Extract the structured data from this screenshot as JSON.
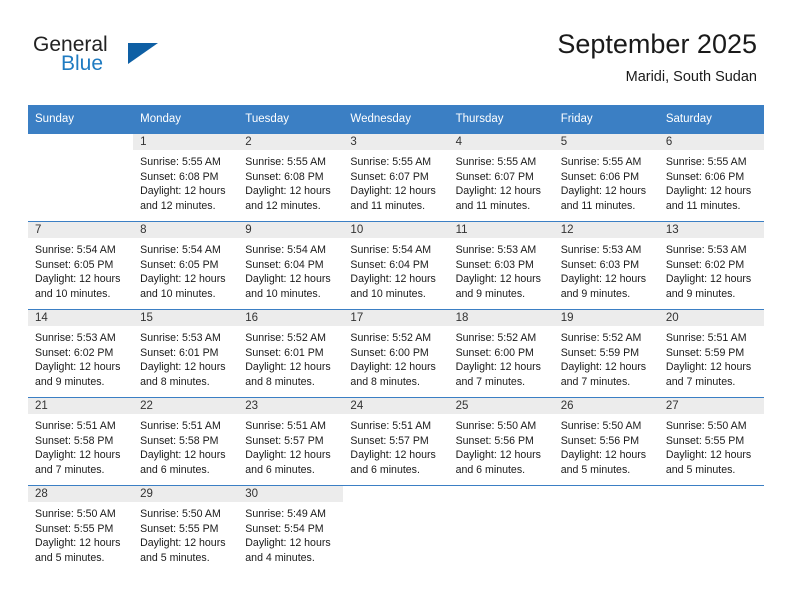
{
  "brand": {
    "word_one": "General",
    "word_two": "Blue",
    "triangle_color": "#0e5fa4",
    "blue_text_color": "#1f7bc1"
  },
  "header": {
    "title": "September 2025",
    "subtitle": "Maridi, South Sudan"
  },
  "theme": {
    "header_row_bg": "#3b7fc4",
    "header_row_text": "#ffffff",
    "daynum_bg": "#f2f2f2",
    "grid_line": "#3b7fc4"
  },
  "calendar": {
    "weekday_headers": [
      "Sunday",
      "Monday",
      "Tuesday",
      "Wednesday",
      "Thursday",
      "Friday",
      "Saturday"
    ],
    "labels": {
      "sunrise": "Sunrise:",
      "sunset": "Sunset:",
      "daylight": "Daylight:"
    },
    "weeks": [
      [
        {
          "day": "",
          "sunrise": "",
          "sunset": "",
          "daylight_line1": "",
          "daylight_line2": ""
        },
        {
          "day": "1",
          "sunrise": "Sunrise: 5:55 AM",
          "sunset": "Sunset: 6:08 PM",
          "daylight_line1": "Daylight: 12 hours",
          "daylight_line2": "and 12 minutes."
        },
        {
          "day": "2",
          "sunrise": "Sunrise: 5:55 AM",
          "sunset": "Sunset: 6:08 PM",
          "daylight_line1": "Daylight: 12 hours",
          "daylight_line2": "and 12 minutes."
        },
        {
          "day": "3",
          "sunrise": "Sunrise: 5:55 AM",
          "sunset": "Sunset: 6:07 PM",
          "daylight_line1": "Daylight: 12 hours",
          "daylight_line2": "and 11 minutes."
        },
        {
          "day": "4",
          "sunrise": "Sunrise: 5:55 AM",
          "sunset": "Sunset: 6:07 PM",
          "daylight_line1": "Daylight: 12 hours",
          "daylight_line2": "and 11 minutes."
        },
        {
          "day": "5",
          "sunrise": "Sunrise: 5:55 AM",
          "sunset": "Sunset: 6:06 PM",
          "daylight_line1": "Daylight: 12 hours",
          "daylight_line2": "and 11 minutes."
        },
        {
          "day": "6",
          "sunrise": "Sunrise: 5:55 AM",
          "sunset": "Sunset: 6:06 PM",
          "daylight_line1": "Daylight: 12 hours",
          "daylight_line2": "and 11 minutes."
        }
      ],
      [
        {
          "day": "7",
          "sunrise": "Sunrise: 5:54 AM",
          "sunset": "Sunset: 6:05 PM",
          "daylight_line1": "Daylight: 12 hours",
          "daylight_line2": "and 10 minutes."
        },
        {
          "day": "8",
          "sunrise": "Sunrise: 5:54 AM",
          "sunset": "Sunset: 6:05 PM",
          "daylight_line1": "Daylight: 12 hours",
          "daylight_line2": "and 10 minutes."
        },
        {
          "day": "9",
          "sunrise": "Sunrise: 5:54 AM",
          "sunset": "Sunset: 6:04 PM",
          "daylight_line1": "Daylight: 12 hours",
          "daylight_line2": "and 10 minutes."
        },
        {
          "day": "10",
          "sunrise": "Sunrise: 5:54 AM",
          "sunset": "Sunset: 6:04 PM",
          "daylight_line1": "Daylight: 12 hours",
          "daylight_line2": "and 10 minutes."
        },
        {
          "day": "11",
          "sunrise": "Sunrise: 5:53 AM",
          "sunset": "Sunset: 6:03 PM",
          "daylight_line1": "Daylight: 12 hours",
          "daylight_line2": "and 9 minutes."
        },
        {
          "day": "12",
          "sunrise": "Sunrise: 5:53 AM",
          "sunset": "Sunset: 6:03 PM",
          "daylight_line1": "Daylight: 12 hours",
          "daylight_line2": "and 9 minutes."
        },
        {
          "day": "13",
          "sunrise": "Sunrise: 5:53 AM",
          "sunset": "Sunset: 6:02 PM",
          "daylight_line1": "Daylight: 12 hours",
          "daylight_line2": "and 9 minutes."
        }
      ],
      [
        {
          "day": "14",
          "sunrise": "Sunrise: 5:53 AM",
          "sunset": "Sunset: 6:02 PM",
          "daylight_line1": "Daylight: 12 hours",
          "daylight_line2": "and 9 minutes."
        },
        {
          "day": "15",
          "sunrise": "Sunrise: 5:53 AM",
          "sunset": "Sunset: 6:01 PM",
          "daylight_line1": "Daylight: 12 hours",
          "daylight_line2": "and 8 minutes."
        },
        {
          "day": "16",
          "sunrise": "Sunrise: 5:52 AM",
          "sunset": "Sunset: 6:01 PM",
          "daylight_line1": "Daylight: 12 hours",
          "daylight_line2": "and 8 minutes."
        },
        {
          "day": "17",
          "sunrise": "Sunrise: 5:52 AM",
          "sunset": "Sunset: 6:00 PM",
          "daylight_line1": "Daylight: 12 hours",
          "daylight_line2": "and 8 minutes."
        },
        {
          "day": "18",
          "sunrise": "Sunrise: 5:52 AM",
          "sunset": "Sunset: 6:00 PM",
          "daylight_line1": "Daylight: 12 hours",
          "daylight_line2": "and 7 minutes."
        },
        {
          "day": "19",
          "sunrise": "Sunrise: 5:52 AM",
          "sunset": "Sunset: 5:59 PM",
          "daylight_line1": "Daylight: 12 hours",
          "daylight_line2": "and 7 minutes."
        },
        {
          "day": "20",
          "sunrise": "Sunrise: 5:51 AM",
          "sunset": "Sunset: 5:59 PM",
          "daylight_line1": "Daylight: 12 hours",
          "daylight_line2": "and 7 minutes."
        }
      ],
      [
        {
          "day": "21",
          "sunrise": "Sunrise: 5:51 AM",
          "sunset": "Sunset: 5:58 PM",
          "daylight_line1": "Daylight: 12 hours",
          "daylight_line2": "and 7 minutes."
        },
        {
          "day": "22",
          "sunrise": "Sunrise: 5:51 AM",
          "sunset": "Sunset: 5:58 PM",
          "daylight_line1": "Daylight: 12 hours",
          "daylight_line2": "and 6 minutes."
        },
        {
          "day": "23",
          "sunrise": "Sunrise: 5:51 AM",
          "sunset": "Sunset: 5:57 PM",
          "daylight_line1": "Daylight: 12 hours",
          "daylight_line2": "and 6 minutes."
        },
        {
          "day": "24",
          "sunrise": "Sunrise: 5:51 AM",
          "sunset": "Sunset: 5:57 PM",
          "daylight_line1": "Daylight: 12 hours",
          "daylight_line2": "and 6 minutes."
        },
        {
          "day": "25",
          "sunrise": "Sunrise: 5:50 AM",
          "sunset": "Sunset: 5:56 PM",
          "daylight_line1": "Daylight: 12 hours",
          "daylight_line2": "and 6 minutes."
        },
        {
          "day": "26",
          "sunrise": "Sunrise: 5:50 AM",
          "sunset": "Sunset: 5:56 PM",
          "daylight_line1": "Daylight: 12 hours",
          "daylight_line2": "and 5 minutes."
        },
        {
          "day": "27",
          "sunrise": "Sunrise: 5:50 AM",
          "sunset": "Sunset: 5:55 PM",
          "daylight_line1": "Daylight: 12 hours",
          "daylight_line2": "and 5 minutes."
        }
      ],
      [
        {
          "day": "28",
          "sunrise": "Sunrise: 5:50 AM",
          "sunset": "Sunset: 5:55 PM",
          "daylight_line1": "Daylight: 12 hours",
          "daylight_line2": "and 5 minutes."
        },
        {
          "day": "29",
          "sunrise": "Sunrise: 5:50 AM",
          "sunset": "Sunset: 5:55 PM",
          "daylight_line1": "Daylight: 12 hours",
          "daylight_line2": "and 5 minutes."
        },
        {
          "day": "30",
          "sunrise": "Sunrise: 5:49 AM",
          "sunset": "Sunset: 5:54 PM",
          "daylight_line1": "Daylight: 12 hours",
          "daylight_line2": "and 4 minutes."
        },
        {
          "day": "",
          "sunrise": "",
          "sunset": "",
          "daylight_line1": "",
          "daylight_line2": ""
        },
        {
          "day": "",
          "sunrise": "",
          "sunset": "",
          "daylight_line1": "",
          "daylight_line2": ""
        },
        {
          "day": "",
          "sunrise": "",
          "sunset": "",
          "daylight_line1": "",
          "daylight_line2": ""
        },
        {
          "day": "",
          "sunrise": "",
          "sunset": "",
          "daylight_line1": "",
          "daylight_line2": ""
        }
      ]
    ]
  }
}
